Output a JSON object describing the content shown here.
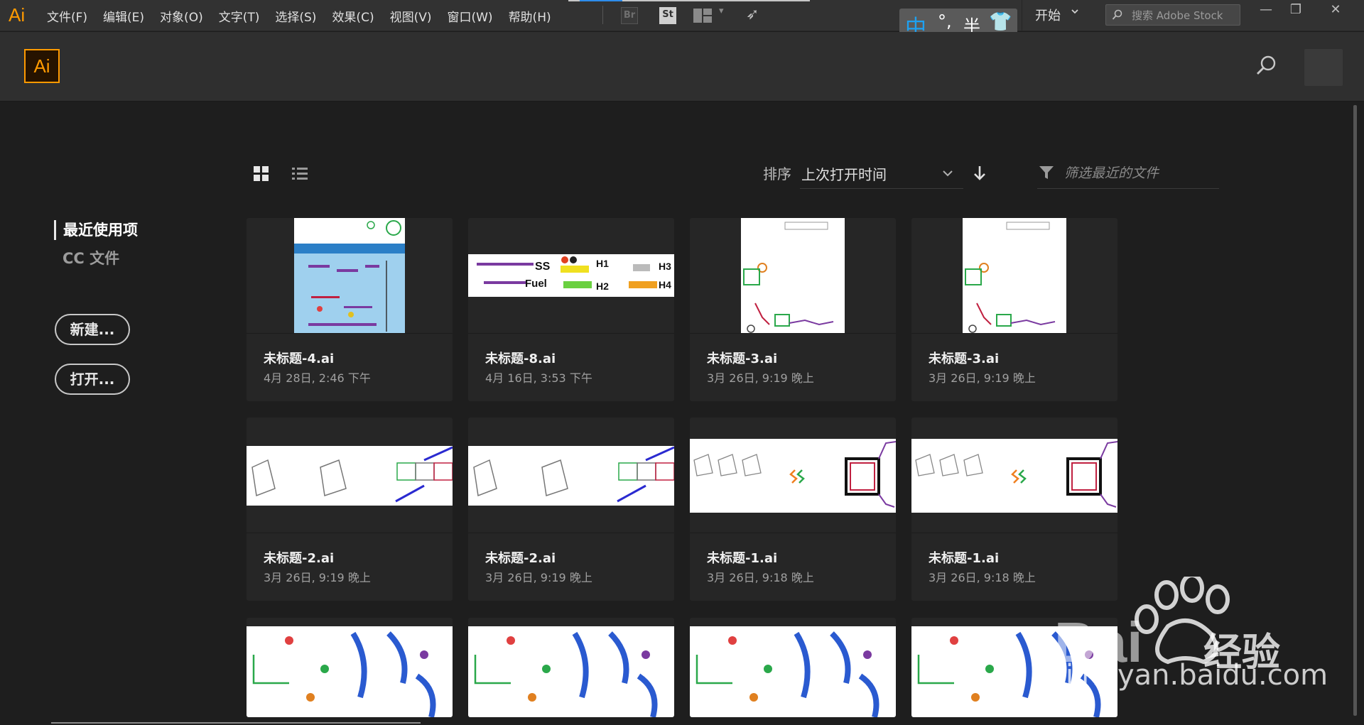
{
  "menubar": {
    "app_mark": "Ai",
    "items": [
      "文件(F)",
      "编辑(E)",
      "对象(O)",
      "文字(T)",
      "选择(S)",
      "效果(C)",
      "视图(V)",
      "窗口(W)",
      "帮助(H)"
    ],
    "bridge_label": "Br",
    "stock_label": "St",
    "workspace": "开始",
    "stock_search_placeholder": "搜索 Adobe Stock",
    "window_controls": [
      "—",
      "❐",
      "✕"
    ]
  },
  "ime": {
    "mode": "中",
    "punct": "°,",
    "width": "半",
    "skin_icon": "shirt-icon"
  },
  "header": {
    "logo": "Ai"
  },
  "nav": {
    "recent": "最近使用项",
    "cc_files": "CC 文件"
  },
  "actions": {
    "new": "新建...",
    "open": "打开..."
  },
  "toolbar": {
    "sort_label": "排序",
    "sort_value": "上次打开时间",
    "filter_placeholder": "筛选最近的文件"
  },
  "files": [
    {
      "name": "未标题-4.ai",
      "date": "4月 28日, 2:46 下午"
    },
    {
      "name": "未标题-8.ai",
      "date": "4月 16日, 3:53 下午"
    },
    {
      "name": "未标题-3.ai",
      "date": "3月 26日, 9:19 晚上"
    },
    {
      "name": "未标题-3.ai",
      "date": "3月 26日, 9:19 晚上"
    },
    {
      "name": "未标题-2.ai",
      "date": "3月 26日, 9:19 晚上"
    },
    {
      "name": "未标题-2.ai",
      "date": "3月 26日, 9:19 晚上"
    },
    {
      "name": "未标题-1.ai",
      "date": "3月 26日, 9:18 晚上"
    },
    {
      "name": "未标题-1.ai",
      "date": "3月 26日, 9:18 晚上"
    }
  ],
  "thumb_labels": {
    "t8_ss": "SS",
    "t8_fuel": "Fuel",
    "t8_h1": "H1",
    "t8_h2": "H2",
    "t8_h3": "H3",
    "t8_h4": "H4"
  },
  "watermark": {
    "text": "经验",
    "url": "jingyan.baidu.com"
  },
  "colors": {
    "accent": "#ff9a00",
    "ime_blue": "#1da1f2",
    "background": "#1e1e1e",
    "card": "#262626"
  }
}
